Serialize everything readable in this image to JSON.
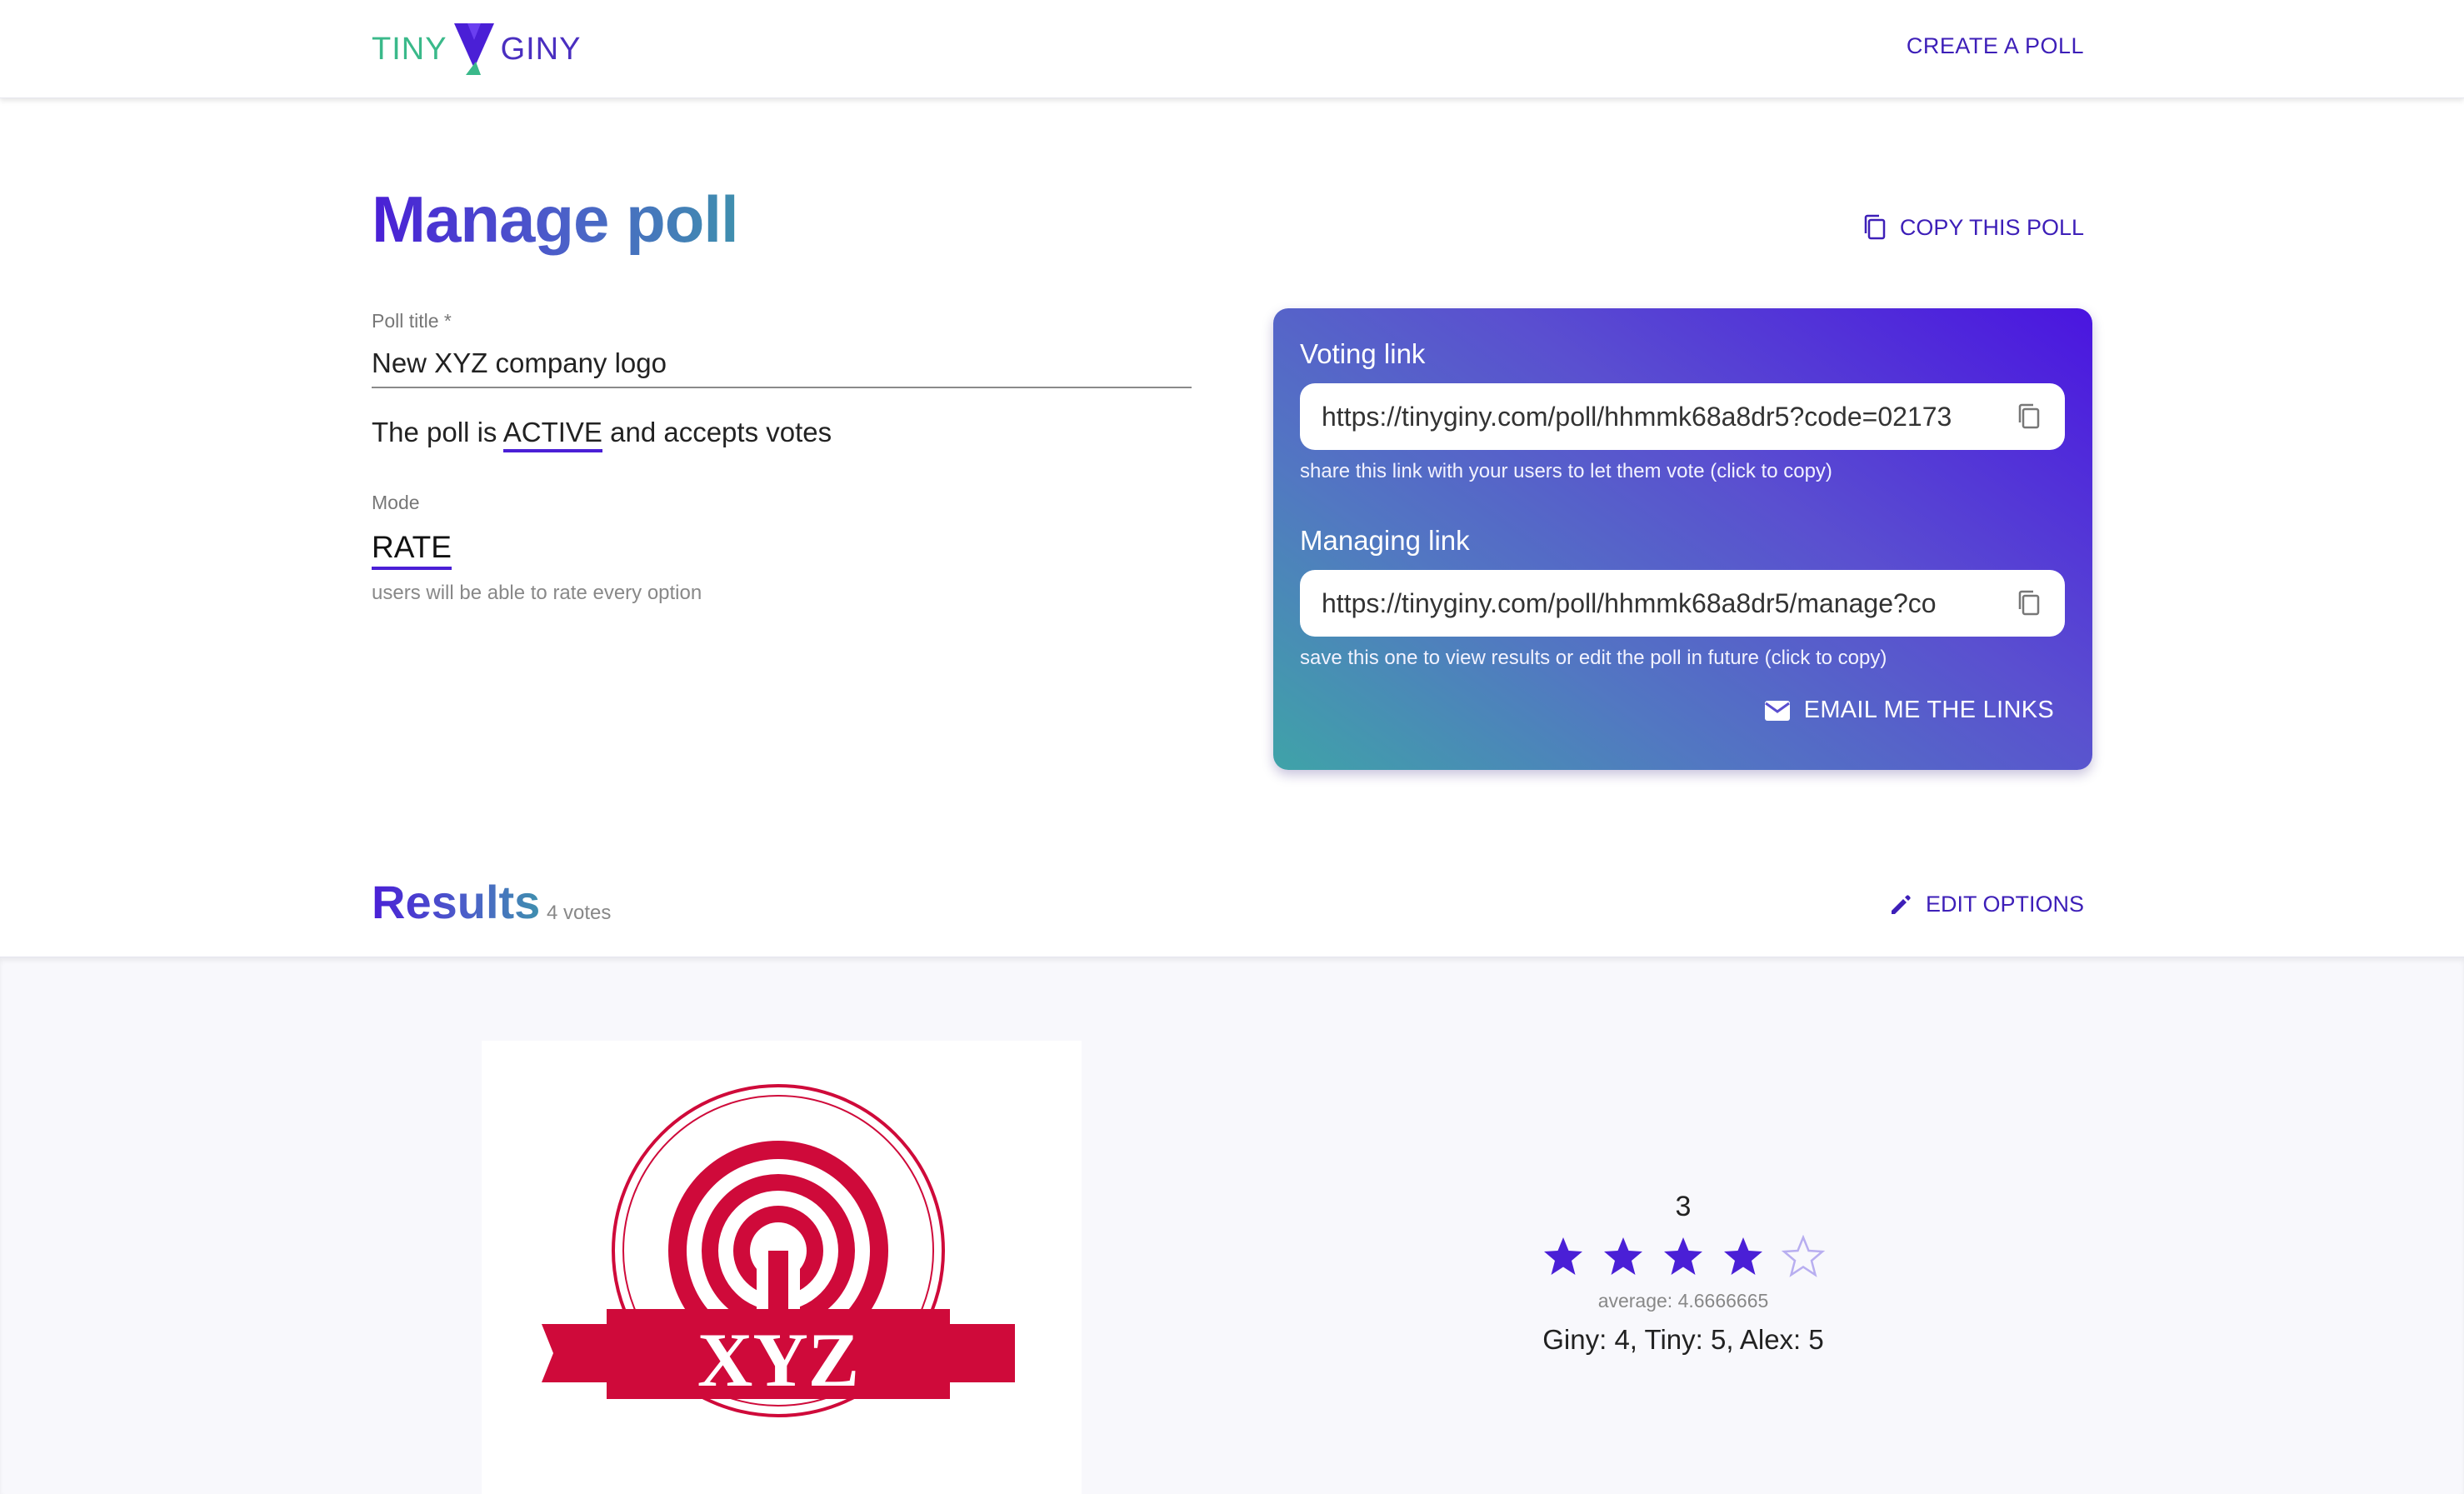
{
  "header": {
    "logo_left": "TINY",
    "logo_right": "GINY",
    "create_poll": "CREATE A POLL"
  },
  "page": {
    "title_part1": "Manage ",
    "title_part2": "poll",
    "copy_poll": "COPY THIS POLL"
  },
  "form": {
    "title_label": "Poll title *",
    "title_value": "New XYZ company logo",
    "status_prefix": "The poll is ",
    "status_value": "ACTIVE",
    "status_suffix": " and accepts votes",
    "mode_label": "Mode",
    "mode_value": "RATE",
    "mode_hint": "users will be able to rate every option"
  },
  "links": {
    "voting_heading": "Voting link",
    "voting_url": "https://tinyginy.com/poll/hhmmk68a8dr5?code=02173",
    "voting_hint": "share this link with your users to let them vote (click to copy)",
    "managing_heading": "Managing link",
    "managing_url": "https://tinyginy.com/poll/hhmmk68a8dr5/manage?co",
    "managing_hint": "save this one to view results or edit the poll in future (click to copy)",
    "email_button": "EMAIL ME THE LINKS"
  },
  "results": {
    "title": "Results",
    "votes": "4 votes",
    "edit_options": "EDIT OPTIONS",
    "option": {
      "logo_text": "XYZ",
      "rating_count": "3",
      "stars_filled": 4,
      "stars_total": 5,
      "average": "average: 4.6666665",
      "votes_detail": "Giny: 4, Tiny: 5, Alex: 5"
    }
  },
  "colors": {
    "accent": "#4a1fd6",
    "logo_green": "#3ab98a",
    "logo_red": "#cf0a3a"
  }
}
